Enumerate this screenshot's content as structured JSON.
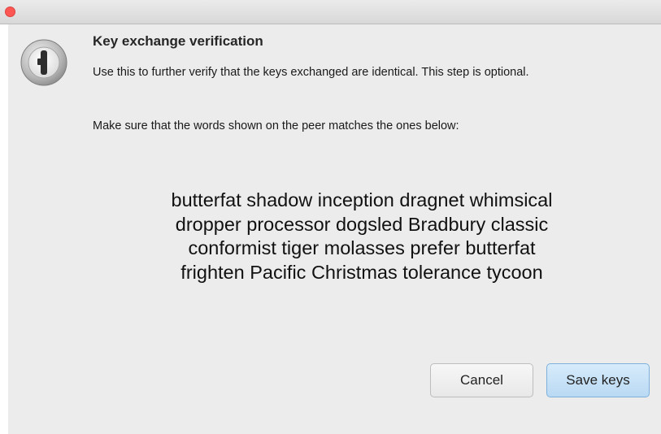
{
  "window": {
    "close_button_color": "#fc5753"
  },
  "dialog": {
    "icon": "1password-keyhole-icon",
    "heading": "Key exchange verification",
    "description": "Use this to further verify that the keys exchanged are identical. This step is optional.",
    "instruction": "Make sure that the words shown on the peer matches the ones below:",
    "words": [
      "butterfat shadow inception dragnet whimsical",
      "dropper processor dogsled Bradbury classic",
      "conformist tiger molasses prefer butterfat",
      "frighten Pacific Christmas tolerance tycoon"
    ]
  },
  "buttons": {
    "cancel_label": "Cancel",
    "save_label": "Save keys",
    "save_accent": "#b9d9f3"
  }
}
